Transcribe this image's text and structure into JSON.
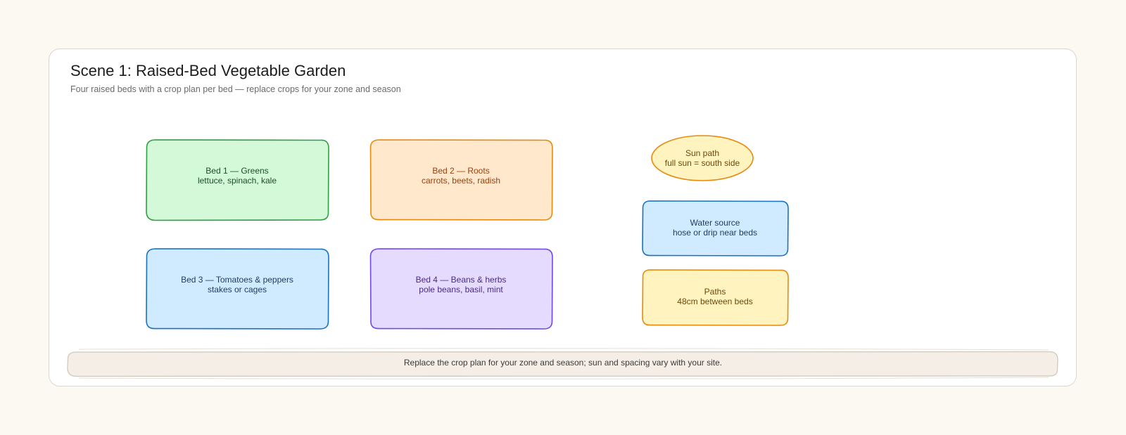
{
  "scene": {
    "title": "Scene 1: Raised-Bed Vegetable Garden",
    "subtitle": "Four raised beds with a crop plan per bed — replace crops for your zone and season"
  },
  "nodes": {
    "bed1": {
      "title": "Bed 1 — Greens",
      "detail": "lettuce, spinach, kale",
      "fill": "#d3f9d8",
      "stroke": "#2f9e44",
      "text_color": "#1b4d2a"
    },
    "bed2": {
      "title": "Bed 2 — Roots",
      "detail": "carrots, beets, radish",
      "fill": "#ffe8cc",
      "stroke": "#e8890c",
      "text_color": "#9c3f0b"
    },
    "bed3": {
      "title": "Bed 3 — Tomatoes & peppers",
      "detail": "stakes or cages",
      "fill": "#d0ebff",
      "stroke": "#1971c2",
      "text_color": "#1e3a5f"
    },
    "bed4": {
      "title": "Bed 4 — Beans & herbs",
      "detail": "pole beans, basil, mint",
      "fill": "#e5dbff",
      "stroke": "#7048e8",
      "text_color": "#4a2a86"
    },
    "sun": {
      "title": "Sun path",
      "detail": "full sun = south side",
      "fill": "#fff3bf",
      "stroke": "#e8890c",
      "text_color": "#6b4a0a"
    },
    "water": {
      "title": "Water source",
      "detail": "hose or drip near beds",
      "fill": "#d0ebff",
      "stroke": "#1971c2",
      "text_color": "#1e3a5f"
    },
    "paths": {
      "title": "Paths",
      "detail": "48cm between beds",
      "fill": "#fff3bf",
      "stroke": "#e8890c",
      "text_color": "#6b4a0a"
    }
  },
  "footer": {
    "note": "Replace the crop plan for your zone and season; sun and spacing vary with your site."
  }
}
